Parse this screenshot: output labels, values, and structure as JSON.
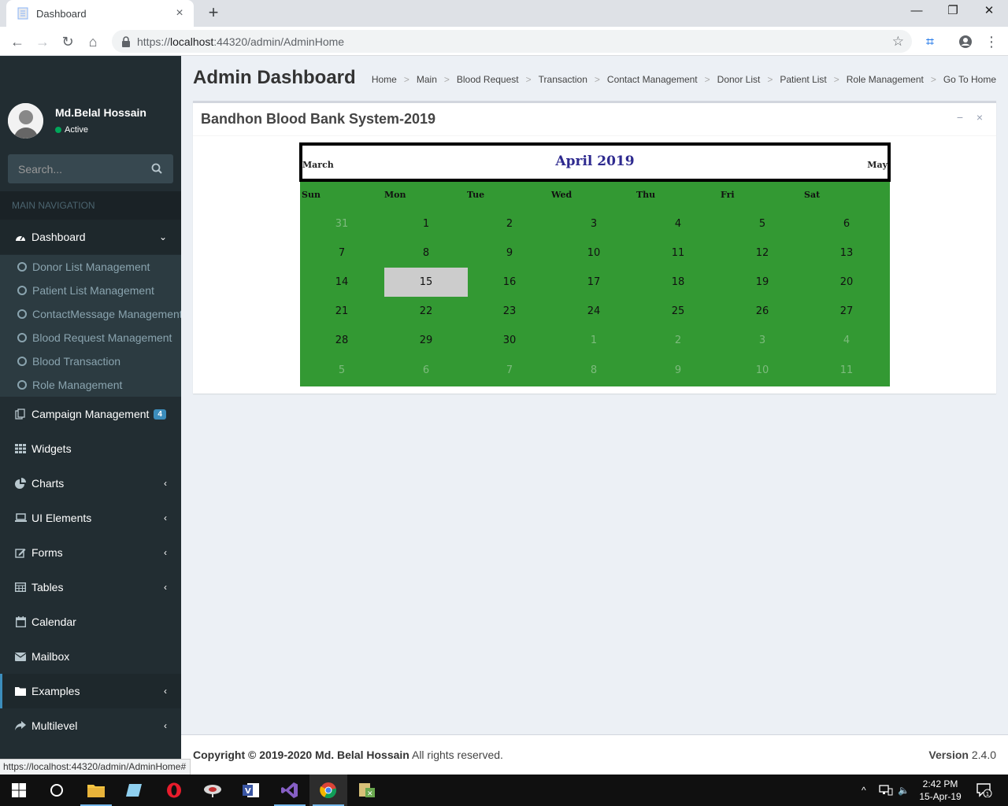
{
  "browser": {
    "tab_title": "Dashboard",
    "new_tab": "+",
    "url_prefix": "https://",
    "url_host": "localhost",
    "url_rest": ":44320/admin/AdminHome",
    "status_url": "https://localhost:44320/admin/AdminHome#"
  },
  "sidebar": {
    "user_name": "Md.Belal Hossain",
    "user_status": "Active",
    "search_placeholder": "Search...",
    "nav_header": "MAIN NAVIGATION",
    "items": [
      {
        "label": "Dashboard",
        "icon": "dashboard-icon"
      },
      {
        "label": "Campaign Management",
        "icon": "files-icon",
        "badge": "4"
      },
      {
        "label": "Widgets",
        "icon": "th-icon"
      },
      {
        "label": "Charts",
        "icon": "pie-chart-icon"
      },
      {
        "label": "UI Elements",
        "icon": "laptop-icon"
      },
      {
        "label": "Forms",
        "icon": "edit-icon"
      },
      {
        "label": "Tables",
        "icon": "table-icon"
      },
      {
        "label": "Calendar",
        "icon": "calendar-icon"
      },
      {
        "label": "Mailbox",
        "icon": "envelope-icon"
      },
      {
        "label": "Examples",
        "icon": "folder-icon"
      },
      {
        "label": "Multilevel",
        "icon": "share-icon"
      }
    ],
    "submenu": [
      "Donor List Management",
      "Patient List Management",
      "ContactMessage Management",
      "Blood Request Management",
      "Blood Transaction",
      "Role Management"
    ]
  },
  "header": {
    "title": "Admin Dashboard",
    "breadcrumb": [
      "Home",
      "Main",
      "Blood Request",
      "Transaction",
      "Contact Management",
      "Donor List",
      "Patient List",
      "Role Management",
      "Go To Home"
    ],
    "separator": ">"
  },
  "box": {
    "title": "Bandhon Blood Bank System-2019",
    "collapse": "−",
    "remove": "×"
  },
  "calendar": {
    "title": "April 2019",
    "prev": "March",
    "next": "May",
    "days_of_week": [
      "Sun",
      "Mon",
      "Tue",
      "Wed",
      "Thu",
      "Fri",
      "Sat"
    ],
    "weeks": [
      [
        "31",
        "1",
        "2",
        "3",
        "4",
        "5",
        "6"
      ],
      [
        "7",
        "8",
        "9",
        "10",
        "11",
        "12",
        "13"
      ],
      [
        "14",
        "15",
        "16",
        "17",
        "18",
        "19",
        "20"
      ],
      [
        "21",
        "22",
        "23",
        "24",
        "25",
        "26",
        "27"
      ],
      [
        "28",
        "29",
        "30",
        "1",
        "2",
        "3",
        "4"
      ],
      [
        "5",
        "6",
        "7",
        "8",
        "9",
        "10",
        "11"
      ]
    ],
    "selected": "15",
    "colors": {
      "body": "#339933",
      "title": "#2e2a8f",
      "today": "#cccccc"
    }
  },
  "footer": {
    "copyright_prefix": "Copyright © 2019-2020",
    "copyright_name": "Md. Belal Hossain",
    "copyright_suffix": " All rights reserved.",
    "version_label": "Version",
    "version": " 2.4.0"
  },
  "taskbar": {
    "time": "2:42 PM",
    "date": "15-Apr-19",
    "notifications": "1"
  }
}
